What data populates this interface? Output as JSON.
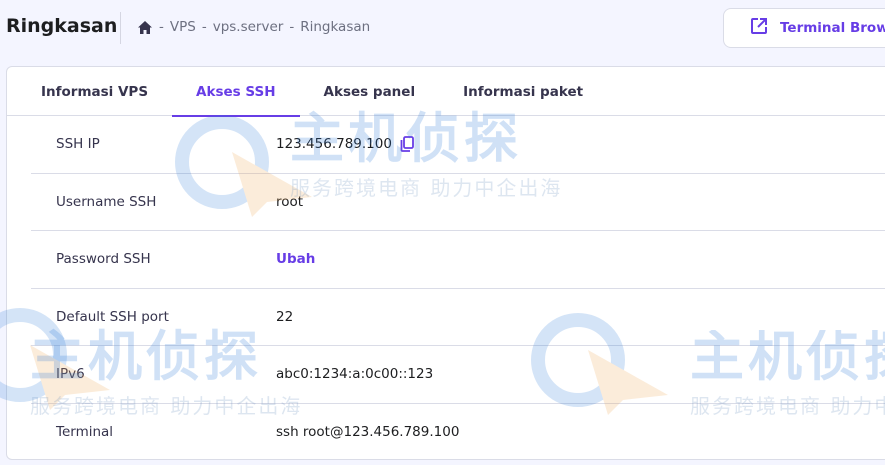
{
  "header": {
    "title": "Ringkasan",
    "breadcrumb": [
      "VPS",
      "vps.server",
      "Ringkasan"
    ],
    "terminal_button": "Terminal Browser"
  },
  "tabs": [
    {
      "label": "Informasi VPS",
      "active": false
    },
    {
      "label": "Akses SSH",
      "active": true
    },
    {
      "label": "Akses panel",
      "active": false
    },
    {
      "label": "Informasi paket",
      "active": false
    }
  ],
  "rows": [
    {
      "label": "SSH IP",
      "value": "123.456.789.100"
    },
    {
      "label": "Username SSH",
      "value": "root"
    },
    {
      "label": "Password SSH",
      "value": "Ubah"
    },
    {
      "label": "Default SSH port",
      "value": "22"
    },
    {
      "label": "IPv6",
      "value": "abc0:1234:a:0c00::123"
    },
    {
      "label": "Terminal",
      "value": "ssh root@123.456.789.100"
    }
  ],
  "watermark": {
    "brand": "主机侦探",
    "slogan": "服务跨境电商 助力中企出海"
  },
  "colors": {
    "accent": "#673de6",
    "text": "#1d1e20",
    "border": "#dadce7",
    "background": "#f4f5ff"
  }
}
